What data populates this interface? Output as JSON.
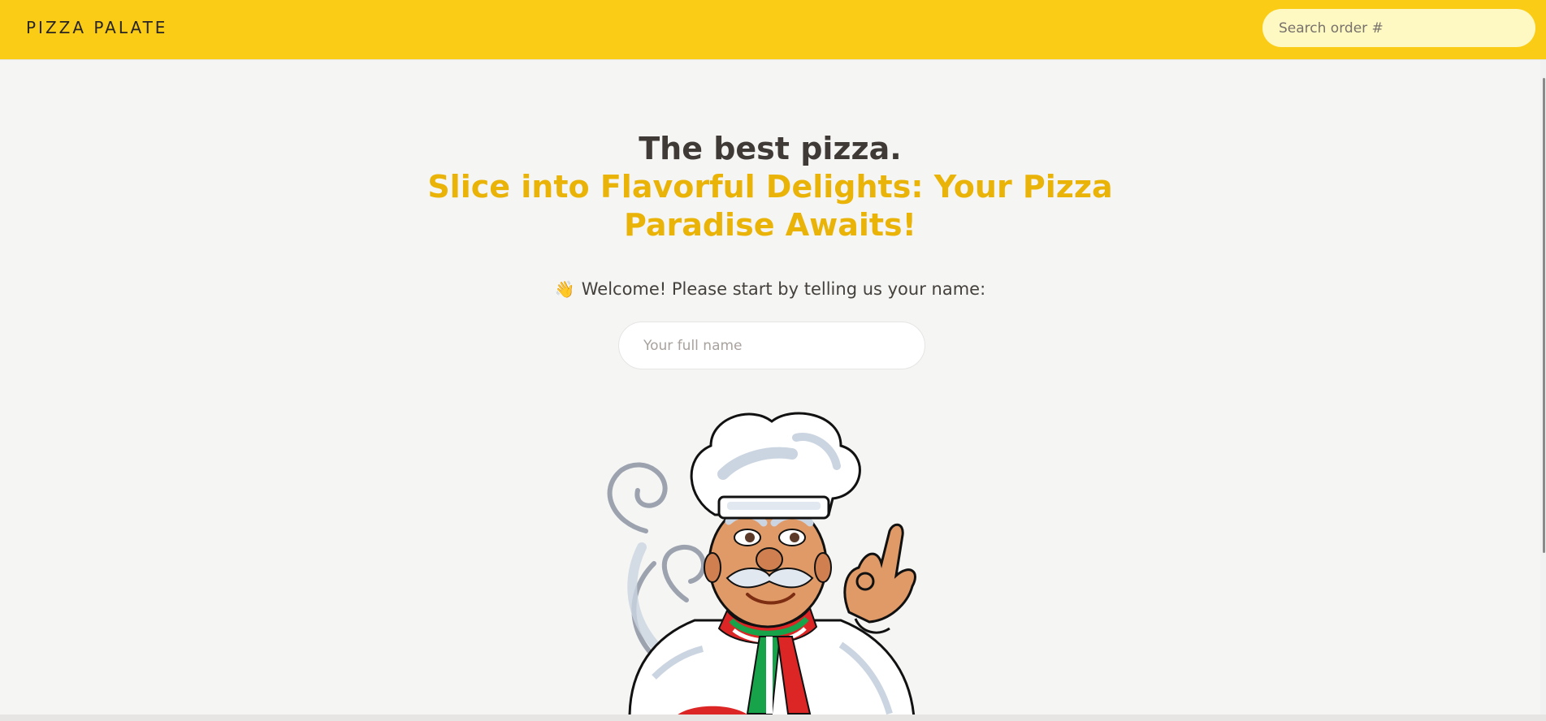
{
  "header": {
    "logo": "Pizza Palate",
    "search_placeholder": "Search order #"
  },
  "hero": {
    "title": "The best pizza.",
    "subtitle": "Slice into Flavorful Delights: Your Pizza Paradise Awaits!"
  },
  "welcome": {
    "emoji": "👋",
    "text": "Welcome! Please start by telling us your name:",
    "name_placeholder": "Your full name"
  },
  "colors": {
    "brand_yellow": "#facc15",
    "accent": "#eab308",
    "background": "#f5f5f4"
  },
  "icons": {
    "chef": "chef-illustration-icon"
  }
}
